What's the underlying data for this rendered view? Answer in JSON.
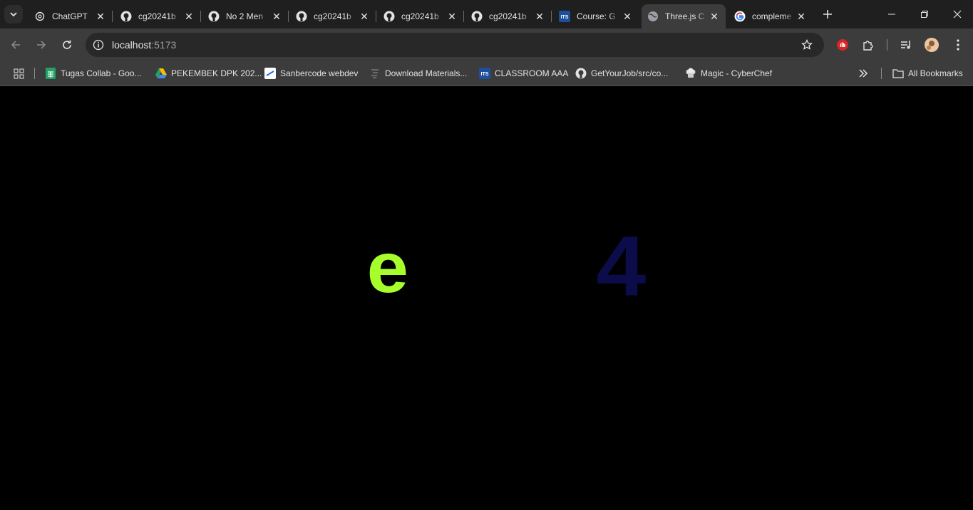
{
  "browser": {
    "tabs": [
      {
        "title": "ChatGPT",
        "icon": "chatgpt-icon",
        "active": false
      },
      {
        "title": "cg20241b",
        "icon": "github-icon",
        "active": false
      },
      {
        "title": "No 2 Men",
        "icon": "github-icon",
        "active": false
      },
      {
        "title": "cg20241b",
        "icon": "github-icon",
        "active": false
      },
      {
        "title": "cg20241b",
        "icon": "github-icon",
        "active": false
      },
      {
        "title": "cg20241b",
        "icon": "github-icon",
        "active": false
      },
      {
        "title": "Course: G",
        "icon": "its-icon",
        "active": false
      },
      {
        "title": "Three.js C",
        "icon": "globe-icon",
        "active": true
      },
      {
        "title": "compleme",
        "icon": "google-icon",
        "active": false
      }
    ],
    "address": {
      "host": "localhost",
      "port": ":5173"
    },
    "bookmarks": [
      {
        "label": "Tugas Collab - Goo...",
        "icon": "sheets-icon"
      },
      {
        "label": "PEKEMBEK DPK 202...",
        "icon": "drive-icon"
      },
      {
        "label": "Sanbercode webdev",
        "icon": "sanbercode-icon"
      },
      {
        "label": "Download Materials...",
        "icon": "doc-icon"
      },
      {
        "label": "CLASSROOM AAA",
        "icon": "its-icon"
      },
      {
        "label": "GetYourJob/src/co...",
        "icon": "github-icon"
      },
      {
        "label": "Magic - CyberChef",
        "icon": "chef-icon"
      }
    ],
    "all_bookmarks_label": "All Bookmarks"
  },
  "scene": {
    "glyph_left": "e",
    "glyph_right": "4",
    "colors": {
      "left": "#a6ff2b",
      "right": "#0c0c4a",
      "background": "#000000"
    }
  }
}
